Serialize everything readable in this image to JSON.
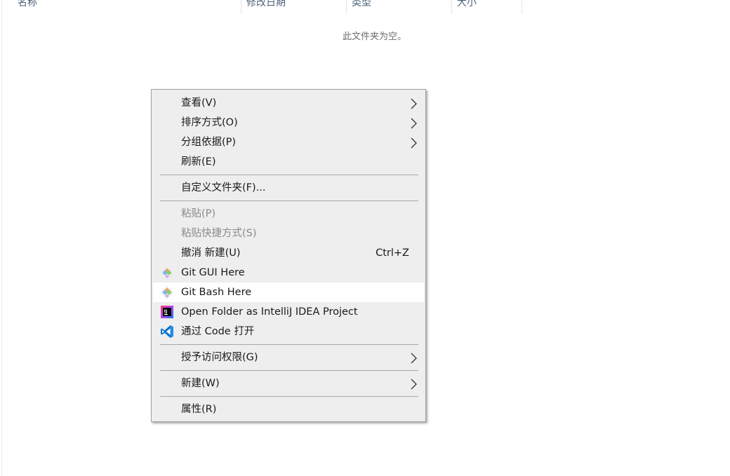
{
  "columns": {
    "name": "名称",
    "modified": "修改日期",
    "type": "类型",
    "size": "大小"
  },
  "empty_message": "此文件夹为空。",
  "menu": {
    "view": "查看(V)",
    "sort_by": "排序方式(O)",
    "group_by": "分组依据(P)",
    "refresh": "刷新(E)",
    "customize": "自定义文件夹(F)...",
    "paste": "粘贴(P)",
    "paste_shortcut": "粘贴快捷方式(S)",
    "undo_new": "撤消 新建(U)",
    "undo_shortcut": "Ctrl+Z",
    "git_gui": "Git GUI Here",
    "git_bash": "Git Bash Here",
    "intellij": "Open Folder as IntelliJ IDEA Project",
    "vscode": "通过 Code 打开",
    "grant_access": "授予访问权限(G)",
    "new": "新建(W)",
    "properties": "属性(R)"
  },
  "icons": {
    "git": "git-diamond-icon",
    "intellij": "intellij-idea-icon",
    "vscode": "vscode-icon",
    "submenu": "chevron-right-icon"
  },
  "colors": {
    "menu_bg": "#eeeeee",
    "hover_bg": "#ffffff",
    "disabled_text": "#8a8a8a",
    "header_text": "#4c607a",
    "vscode_blue": "#0078d4"
  }
}
